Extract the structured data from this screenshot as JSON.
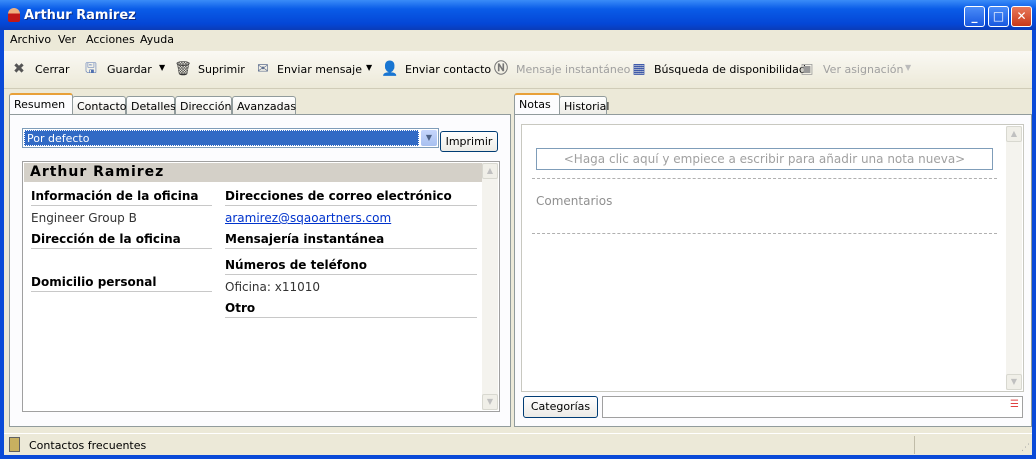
{
  "window": {
    "title": "Arthur Ramirez",
    "buttons": [
      "_",
      "□",
      "✕"
    ]
  },
  "menu": [
    "Archivo",
    "Ver",
    "Acciones",
    "Ayuda"
  ],
  "toolbar": {
    "close": "Cerrar",
    "save": "Guardar",
    "delete": "Suprimir",
    "send_message": "Enviar mensaje",
    "send_contact": "Enviar contacto",
    "instant_message": "Mensaje instantáneo",
    "availability": "Búsqueda de disponibilidad",
    "view_map": "Ver asignación"
  },
  "left": {
    "tabs": [
      "Resumen",
      "Contacto",
      "Detalles",
      "Dirección",
      "Avanzadas"
    ],
    "view_select": "Por defecto",
    "print": "Imprimir",
    "card": {
      "name": "Arthur Ramirez",
      "office_info": "Información de la oficina",
      "department": "Engineer Group B",
      "office_address": "Dirección de la oficina",
      "home_address": "Domicilio personal",
      "emails": "Direcciones de correo electrónico",
      "email": "aramirez@sqaoartners.com",
      "im": "Mensajería instantánea",
      "phones": "Números de teléfono",
      "phone": "Oficina: x11010",
      "other": "Otro"
    }
  },
  "right": {
    "tabs": [
      "Notas",
      "Historial"
    ],
    "note_placeholder": "<Haga clic aquí y empiece a escribir para añadir una nota nueva>",
    "comments": "Comentarios",
    "categories": "Categorías",
    "categories_value": ""
  },
  "status": {
    "text": "Contactos frecuentes"
  }
}
